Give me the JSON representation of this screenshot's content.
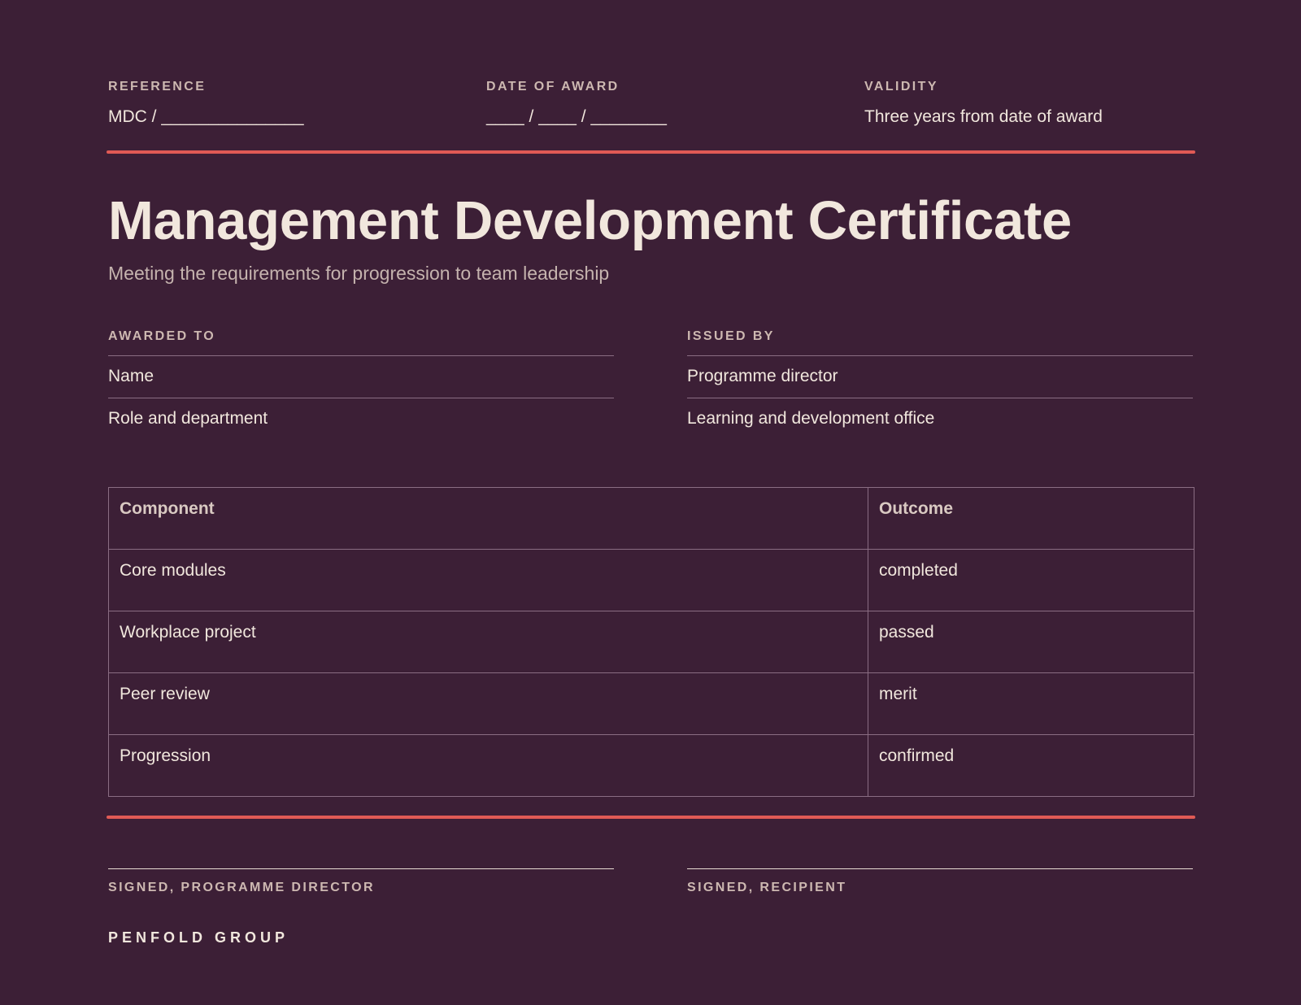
{
  "meta": {
    "reference": {
      "label": "REFERENCE",
      "value": "MDC / _______________"
    },
    "date_of_award": {
      "label": "DATE OF AWARD",
      "value": "____ / ____ / ________"
    },
    "validity": {
      "label": "VALIDITY",
      "value": "Three years from date of award"
    }
  },
  "certificate": {
    "title": "Management Development Certificate",
    "subtitle": "Meeting the requirements for progression to team leadership"
  },
  "awarded_to": {
    "label": "AWARDED TO",
    "lines": [
      "Name",
      "Role and department"
    ]
  },
  "issued_by": {
    "label": "ISSUED BY",
    "lines": [
      "Programme director",
      "Learning and development office"
    ]
  },
  "table": {
    "headers": [
      "Component",
      "Outcome"
    ],
    "rows": [
      [
        "Core modules",
        "completed"
      ],
      [
        "Workplace project",
        "passed"
      ],
      [
        "Peer review",
        "merit"
      ],
      [
        "Progression",
        "confirmed"
      ]
    ]
  },
  "signatures": {
    "left": "SIGNED, PROGRAMME DIRECTOR",
    "right": "SIGNED, RECIPIENT"
  },
  "organisation": "PENFOLD GROUP",
  "colors": {
    "background": "#3c1f36",
    "accent": "#e05a55",
    "text": "#f1e7dd",
    "muted": "#cdb8b1"
  }
}
